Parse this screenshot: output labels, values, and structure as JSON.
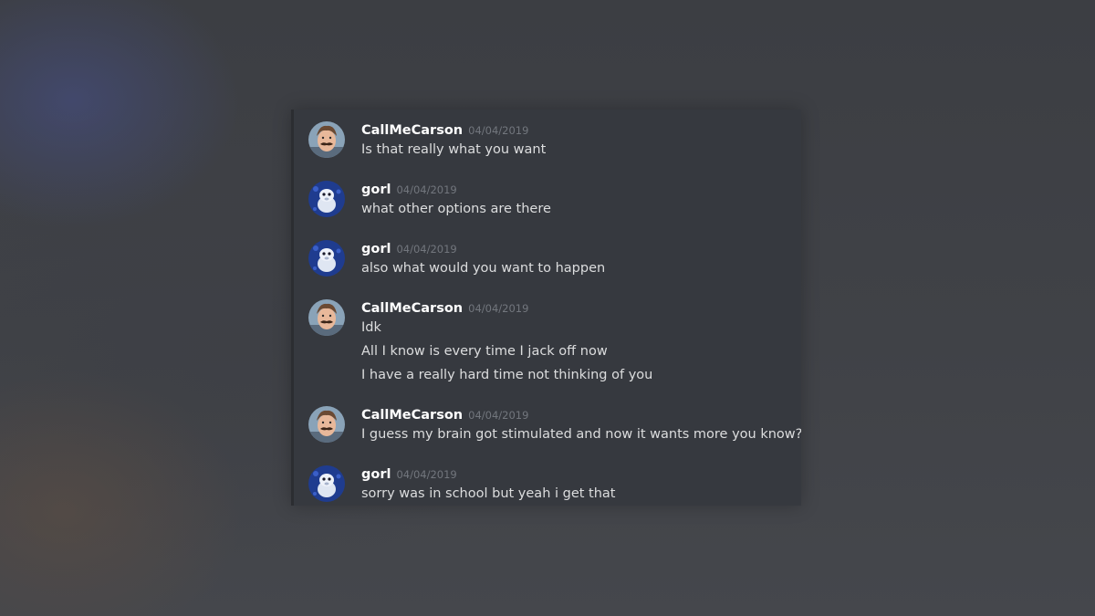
{
  "messages": [
    {
      "author": "CallMeCarson",
      "timestamp": "04/04/2019",
      "lines": [
        "Is that really what you want"
      ]
    },
    {
      "author": "gorl",
      "timestamp": "04/04/2019",
      "lines": [
        "what other options are there"
      ]
    },
    {
      "author": "gorl",
      "timestamp": "04/04/2019",
      "lines": [
        "also what would you want to happen"
      ]
    },
    {
      "author": "CallMeCarson",
      "timestamp": "04/04/2019",
      "lines": [
        "Idk",
        "All I know is every time I jack off now",
        "I have a really hard time not thinking of you"
      ]
    },
    {
      "author": "CallMeCarson",
      "timestamp": "04/04/2019",
      "lines": [
        "I guess my brain got stimulated and now it wants more you know?"
      ]
    },
    {
      "author": "gorl",
      "timestamp": "04/04/2019",
      "lines": [
        "sorry was in school but yeah i get that"
      ]
    }
  ],
  "colors": {
    "panel_background": "#36393f",
    "username": "#ffffff",
    "timestamp": "#72767d",
    "message_text": "#dcddde"
  },
  "icons": {
    "carson_avatar": "person-mustache-avatar-icon",
    "gorl_avatar": "blue-cartoon-avatar-icon"
  }
}
